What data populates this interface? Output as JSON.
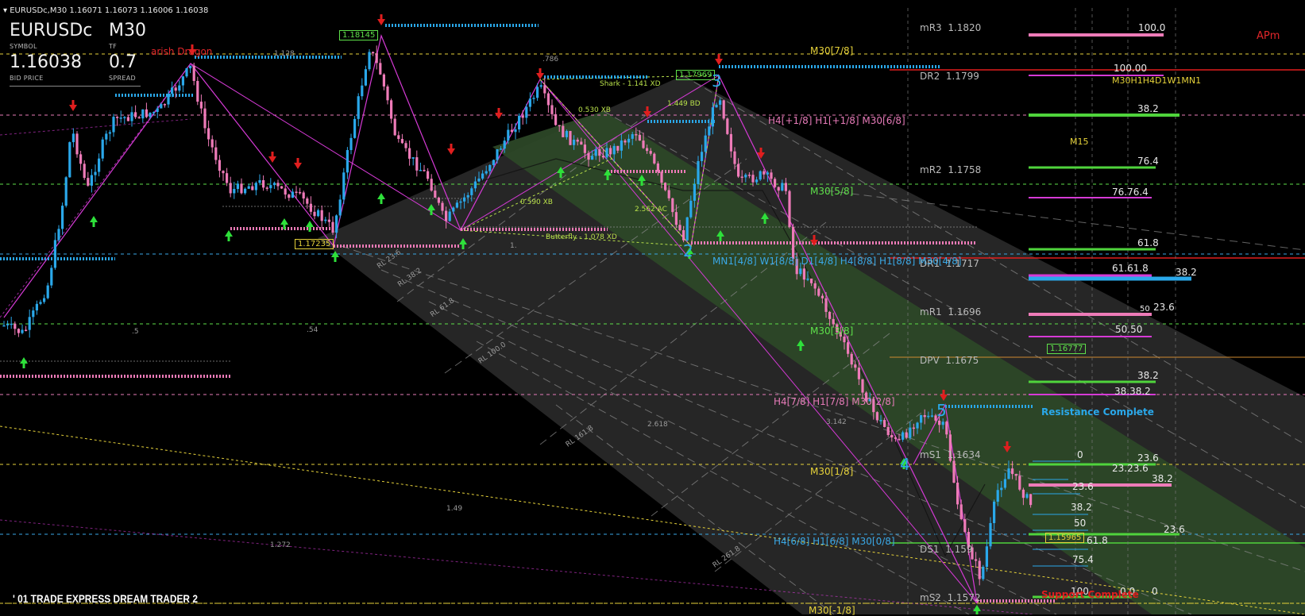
{
  "window": {
    "title": "EURUSDc,M30  1.16071 1.16073 1.16006 1.16038"
  },
  "symbol_box": {
    "symbol": "EURUSDc",
    "symbol_caption": "SYMBOL",
    "timeframe": "M30",
    "timeframe_caption": "TF",
    "bid_price": "1.16038",
    "bid_caption": "BID PRICE",
    "spread": "0.7",
    "spread_caption": "SPREAD"
  },
  "indicator_labels": {
    "bearish_dragon": "arish Dragon",
    "apm": "APm",
    "resistance_complete": "Resistance Complete",
    "support_complete": "Support Complete",
    "footer": "' 01 TRADE EXPRESS DREAM TRADER 2"
  },
  "pivot_levels": [
    {
      "label": "mR3",
      "value": "1.1820"
    },
    {
      "label": "DR2",
      "value": "1.1799"
    },
    {
      "label": "DR1",
      "value": ""
    },
    {
      "label": "mR2",
      "value": "1.1758"
    },
    {
      "label": "DR1",
      "value": "1.1717"
    },
    {
      "label": "mR1",
      "value": "1.1696"
    },
    {
      "label": "DPV",
      "value": "1.1675"
    },
    {
      "label": "mS1",
      "value": "1.1634"
    },
    {
      "label": "DS1",
      "value": "1.159"
    },
    {
      "label": "mS2",
      "value": "1.1572"
    }
  ],
  "murrey_labels": {
    "m78": "M30[7/8]",
    "h4_18": "H4[+1/8] H1[+1/8] M30[6/8]",
    "m58": "M30[5/8]",
    "mn1": "MN1[4/8] W1[8/8] D1[4/8] H4[8/8] H1[8/8] M30[4/8]",
    "m30_3": "M30[3/8]",
    "h4_78": "H4[7/8] H1[7/8] M30[2/8]",
    "m18": "M30[1/8]",
    "h4_68": "H4[6/8] H1[6/8] M30[0/8]",
    "m_18": "M30[-1/8]",
    "tf_row": "M30H1H4D1W1MN1",
    "m15": "M15"
  },
  "price_boxes": {
    "p1": "1.18145",
    "p2": "1.17969",
    "p3": "1.17235",
    "p4": "1.16777",
    "p5": "1.15965"
  },
  "harmonics": {
    "shark": "Shark - 1.141 XD",
    "b0530": "0.530 XB",
    "b1449": "1.449 BD",
    "b0590": "0.590 XB",
    "b2562": "2.562 AC",
    "butterfly": "Butterfly - 1.078 XD"
  },
  "gray_labels": {
    "g1128": "1.128",
    "g786": ".786",
    "g5": ".5",
    "g54": ".54",
    "g2618": "2.618",
    "g3142": "3.142",
    "g149": "1.49",
    "g1272": "1.272",
    "g1": "1.",
    "rl236": "RL 23.6",
    "rl382": "RL 38.2",
    "rl618": "RL 61.8",
    "rl100": "RL 100.0",
    "rl1618": "RL 161.8",
    "rl2618": "RL 261.8"
  },
  "wave_numbers": {
    "w2": "2",
    "w3": "3",
    "w4": "4",
    "w5": "5"
  },
  "fib_right": [
    {
      "text": "100.0"
    },
    {
      "text": "100.00"
    },
    {
      "text": "38.2"
    },
    {
      "text": "76.4"
    },
    {
      "text": "76.76.4"
    },
    {
      "text": "61.8"
    },
    {
      "text": "61.61.8"
    },
    {
      "text": "38.2"
    },
    {
      "text": "23.6"
    },
    {
      "text": "50"
    },
    {
      "text": "50.50"
    },
    {
      "text": "38.2"
    },
    {
      "text": "38.38.2"
    },
    {
      "text": "0"
    },
    {
      "text": "23.6"
    },
    {
      "text": "23.23.6"
    },
    {
      "text": "38.2"
    },
    {
      "text": "23.6"
    },
    {
      "text": "38.2"
    },
    {
      "text": "50"
    },
    {
      "text": "23.6"
    },
    {
      "text": "61.8"
    },
    {
      "text": "75.4"
    },
    {
      "text": "100"
    },
    {
      "text": "0.0"
    },
    {
      "text": "0"
    }
  ],
  "colors": {
    "bull_candle": "#2aa8ea",
    "bear_candle": "#ee7bb8",
    "arrow_up": "#2ee03a",
    "arrow_down": "#e01e1e",
    "channel_fill": "#2f4a2a",
    "channel_gray": "#3a3a3a",
    "magenta": "#d63ad6",
    "pivot_red": "#e01e1e",
    "pivot_green": "#4fd43c"
  }
}
